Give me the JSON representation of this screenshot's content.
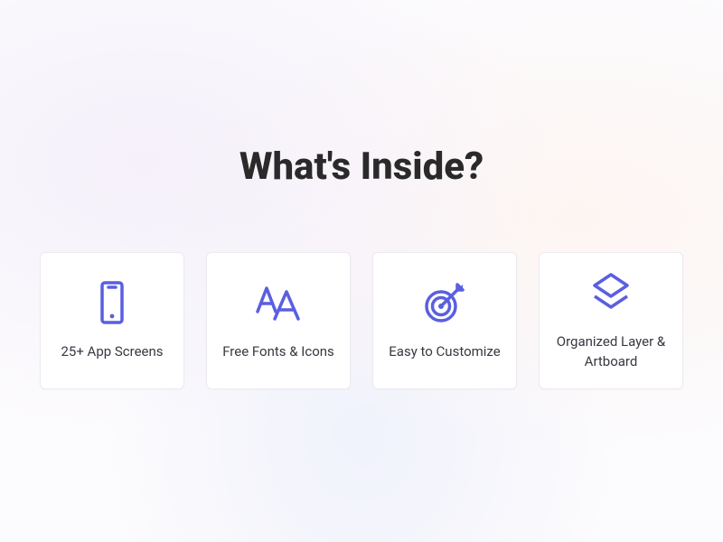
{
  "heading": "What's Inside?",
  "cards": [
    {
      "label": "25+ App Screens"
    },
    {
      "label": "Free Fonts & Icons"
    },
    {
      "label": "Easy to Customize"
    },
    {
      "label": "Organized Layer & Artboard"
    }
  ],
  "accent": "#5a5fe0"
}
